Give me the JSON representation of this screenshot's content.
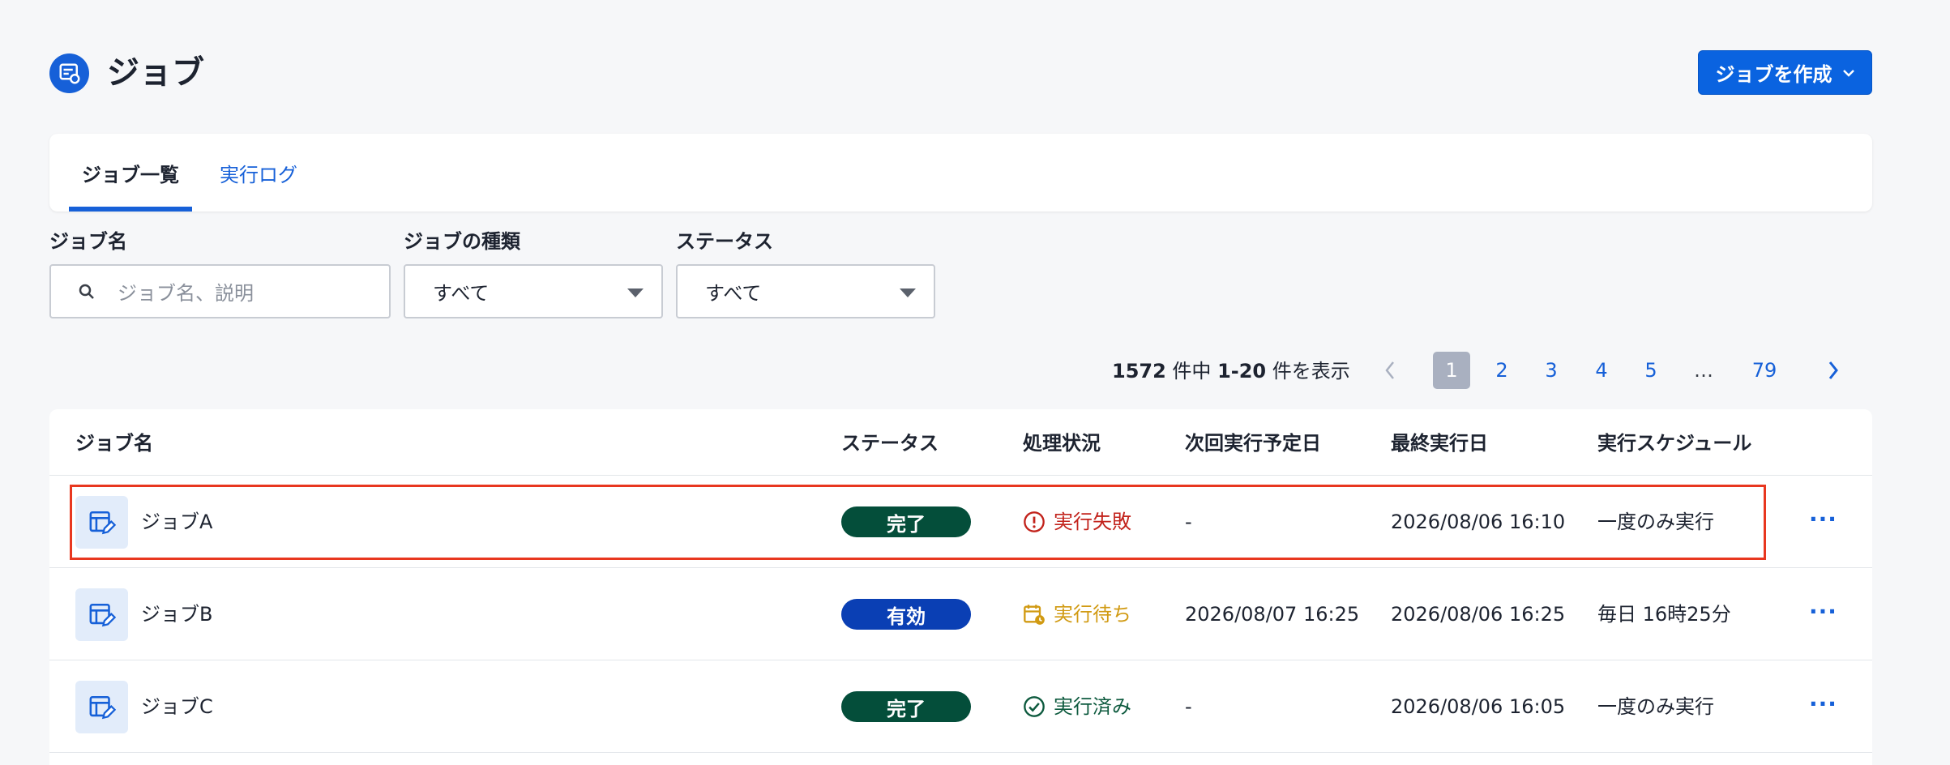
{
  "header": {
    "title": "ジョブ",
    "create_button": "ジョブを作成"
  },
  "tabs": [
    {
      "label": "ジョブ一覧",
      "active": true
    },
    {
      "label": "実行ログ",
      "active": false
    }
  ],
  "filters": {
    "job_name_label": "ジョブ名",
    "job_name_placeholder": "ジョブ名、説明",
    "job_type_label": "ジョブの種類",
    "job_type_value": "すべて",
    "status_label": "ステータス",
    "status_value": "すべて"
  },
  "pagination": {
    "total": "1572",
    "total_suffix": " 件中 ",
    "range": "1-20",
    "range_suffix": " 件を表示",
    "pages": [
      "1",
      "2",
      "3",
      "4",
      "5",
      "…",
      "79"
    ],
    "current": "1"
  },
  "table": {
    "headers": {
      "name": "ジョブ名",
      "status": "ステータス",
      "progress": "処理状況",
      "next_run": "次回実行予定日",
      "last_run": "最終実行日",
      "schedule": "実行スケジュール"
    },
    "rows": [
      {
        "name": "ジョブA",
        "status": "完了",
        "progress": "実行失敗",
        "next_run": "-",
        "last_run": "2026/08/06 16:10",
        "schedule": "一度のみ実行",
        "more": "···"
      },
      {
        "name": "ジョブB",
        "status": "有効",
        "progress": "実行待ち",
        "next_run": "2026/08/07 16:25",
        "last_run": "2026/08/06 16:25",
        "schedule": "毎日 16時25分",
        "more": "···"
      },
      {
        "name": "ジョブC",
        "status": "完了",
        "progress": "実行済み",
        "next_run": "-",
        "last_run": "2026/08/06 16:05",
        "schedule": "一度のみ実行",
        "more": "···"
      }
    ]
  },
  "colors": {
    "primary": "#1660d8",
    "badge_done": "#044e3a",
    "badge_active": "#0a3fb4",
    "failed": "#c2221b",
    "pending": "#d19a12",
    "done": "#0d5a3e",
    "highlight": "#e8371f"
  },
  "icons": {
    "page": "job-list-icon",
    "search": "search-icon",
    "row": "table-edit-icon",
    "failed": "error-circle-icon",
    "pending": "calendar-clock-icon",
    "done": "check-circle-icon"
  }
}
